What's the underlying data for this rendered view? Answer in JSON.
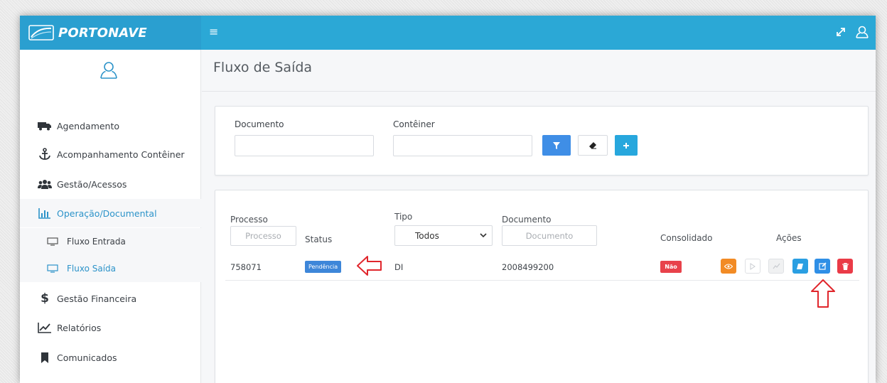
{
  "header": {
    "brand": "PORTONAVE",
    "menu_icon": "hamburger-icon",
    "expand_icon": "expand-icon",
    "user_icon": "user-icon"
  },
  "sidebar": {
    "items": [
      {
        "label": "Agendamento",
        "icon": "truck-icon"
      },
      {
        "label": "Acompanhamento Contêiner",
        "icon": "anchor-icon"
      },
      {
        "label": "Gestão/Acessos",
        "icon": "users-icon"
      },
      {
        "label": "Operação/Documental",
        "icon": "bar-chart-icon"
      },
      {
        "label": "Gestão Financeira",
        "icon": "dollar-icon"
      },
      {
        "label": "Relatórios",
        "icon": "line-chart-icon"
      },
      {
        "label": "Comunicados",
        "icon": "bookmark-icon"
      }
    ],
    "subitems": [
      {
        "label": "Fluxo Entrada",
        "icon": "window-icon"
      },
      {
        "label": "Fluxo Saída",
        "icon": "window-icon"
      }
    ]
  },
  "page": {
    "title": "Fluxo de Saída"
  },
  "filters": {
    "documento_label": "Documento",
    "documento_value": "",
    "conteiner_label": "Contêiner",
    "conteiner_value": ""
  },
  "table": {
    "headers": {
      "processo": "Processo",
      "status": "Status",
      "tipo": "Tipo",
      "documento": "Documento",
      "consolidado": "Consolidado",
      "acoes": "Ações"
    },
    "processo_placeholder": "Processo",
    "documento_placeholder": "Documento",
    "tipo_selected": "Todos",
    "rows": [
      {
        "processo": "758071",
        "status": "Pendência",
        "tipo": "DI",
        "documento": "2008499200",
        "consolidado": "Não"
      }
    ]
  },
  "colors": {
    "topbar": "#2ba8d6",
    "accent_blue": "#3f8ee6",
    "danger": "#ea3b47",
    "warning": "#f28b25",
    "annotation": "#e0262c"
  }
}
